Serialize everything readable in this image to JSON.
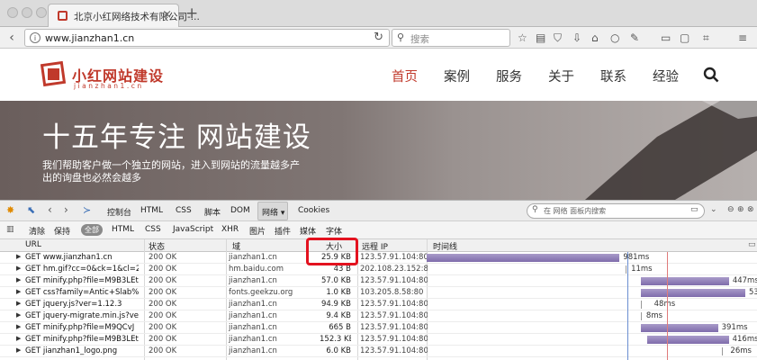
{
  "browser": {
    "tab_title": "北京小红网络技术有限公司-...",
    "tab_close": "×",
    "new_tab": "+",
    "url": "www.jianzhan1.cn",
    "search_placeholder": "搜索"
  },
  "site": {
    "logo_cn": "小红网站建设",
    "logo_en": "jianzhan1.cn",
    "nav": [
      "首页",
      "案例",
      "服务",
      "关于",
      "联系",
      "经验"
    ],
    "accent": "#c0392b"
  },
  "hero": {
    "title": "十五年专注 网站建设",
    "subtitle": "我们帮助客户做一个独立的网站，进入到网站的流量越多产出的询盘也必然会越多"
  },
  "devtools": {
    "tabs": [
      "控制台",
      "HTML",
      "CSS",
      "脚本",
      "DOM",
      "网络 ▾",
      "Cookies"
    ],
    "filter_placeholder": "在 网络 面板内搜索",
    "subtabs": {
      "clear": "清除",
      "persist": "保持",
      "all": "全部",
      "types": [
        "HTML",
        "CSS",
        "JavaScript",
        "XHR",
        "图片",
        "插件",
        "媒体",
        "字体"
      ]
    },
    "columns": {
      "url": "URL",
      "status": "状态",
      "domain": "域",
      "size": "大小",
      "ip": "远程 IP",
      "timeline": "时间线"
    },
    "rows": [
      {
        "url": "GET www.jianzhan1.cn",
        "status": "200 OK",
        "domain": "jianzhan1.cn",
        "size": "25.9 KB",
        "ip": "123.57.91.104:80",
        "time": "981ms",
        "start": 0.0,
        "dur": 0.981
      },
      {
        "url": "GET hm.gif?cc=0&ck=1&cl=2‹",
        "status": "200 OK",
        "domain": "hm.baidu.com",
        "size": "43 B",
        "ip": "202.108.23.152:80",
        "time": "11ms",
        "start": 1.01,
        "dur": 0.011
      },
      {
        "url": "GET minify.php?file=M9B3LEt",
        "status": "200 OK",
        "domain": "jianzhan1.cn",
        "size": "57.0 KB",
        "ip": "123.57.91.104:80",
        "time": "447ms",
        "start": 1.09,
        "dur": 0.447
      },
      {
        "url": "GET css?family=Antic+Slab%3",
        "status": "200 OK",
        "domain": "fonts.geekzu.org",
        "size": "1.0 KB",
        "ip": "103.205.8.58:80",
        "time": "530ms",
        "start": 1.09,
        "dur": 0.53
      },
      {
        "url": "GET jquery.js?ver=1.12.3",
        "status": "200 OK",
        "domain": "jianzhan1.cn",
        "size": "94.9 KB",
        "ip": "123.57.91.104:80",
        "time": "48ms",
        "start": 1.09,
        "dur": 0.048
      },
      {
        "url": "GET jquery-migrate.min.js?ve",
        "status": "200 OK",
        "domain": "jianzhan1.cn",
        "size": "9.4 KB",
        "ip": "123.57.91.104:80",
        "time": "8ms",
        "start": 1.09,
        "dur": 0.008
      },
      {
        "url": "GET minify.php?file=M9QCvJ",
        "status": "200 OK",
        "domain": "jianzhan1.cn",
        "size": "665 B",
        "ip": "123.57.91.104:80",
        "time": "391ms",
        "start": 1.09,
        "dur": 0.391
      },
      {
        "url": "GET minify.php?file=M9B3LEt",
        "status": "200 OK",
        "domain": "jianzhan1.cn",
        "size": "152.3 KB",
        "ip": "123.57.91.104:80",
        "time": "416ms",
        "start": 1.12,
        "dur": 0.416
      },
      {
        "url": "GET jianzhan1_logo.png",
        "status": "200 OK",
        "domain": "jianzhan1.cn",
        "size": "6.0 KB",
        "ip": "123.57.91.104:80",
        "time": "26ms",
        "start": 1.5,
        "dur": 0.026
      }
    ]
  }
}
